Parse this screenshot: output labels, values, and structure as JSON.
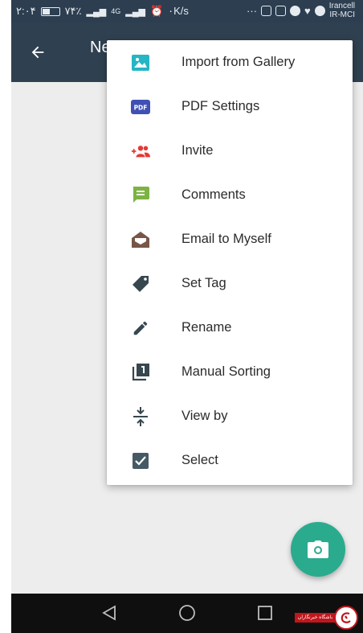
{
  "status_bar": {
    "time": "۲:۰۴",
    "battery_percent": "۷۴٪",
    "network_4g": "4G",
    "network_speed": "۰K/s",
    "carrier_line1": "Irancell",
    "carrier_line2": "IR-MCI"
  },
  "app_bar": {
    "title": "Ne"
  },
  "menu": {
    "items": [
      {
        "label": "Import from Gallery",
        "icon": "image-icon",
        "color": "#26b5c4"
      },
      {
        "label": "PDF Settings",
        "icon": "pdf-icon",
        "color": "#3f51b5"
      },
      {
        "label": "Invite",
        "icon": "add-group-icon",
        "color": "#e53935"
      },
      {
        "label": "Comments",
        "icon": "comment-icon",
        "color": "#7cb342"
      },
      {
        "label": "Email to Myself",
        "icon": "envelope-open-icon",
        "color": "#795548"
      },
      {
        "label": "Set Tag",
        "icon": "tag-icon",
        "color": "#37474f"
      },
      {
        "label": "Rename",
        "icon": "pencil-icon",
        "color": "#37474f"
      },
      {
        "label": "Manual Sorting",
        "icon": "numbered-stack-icon",
        "color": "#37474f"
      },
      {
        "label": "View by",
        "icon": "compress-vertical-icon",
        "color": "#37474f"
      },
      {
        "label": "Select",
        "icon": "checkbox-icon",
        "color": "#455a64"
      }
    ]
  },
  "fab": {
    "icon": "camera-icon",
    "color": "#2aab8e"
  },
  "watermark": {
    "text": "باشگاه خبرنگاران"
  }
}
